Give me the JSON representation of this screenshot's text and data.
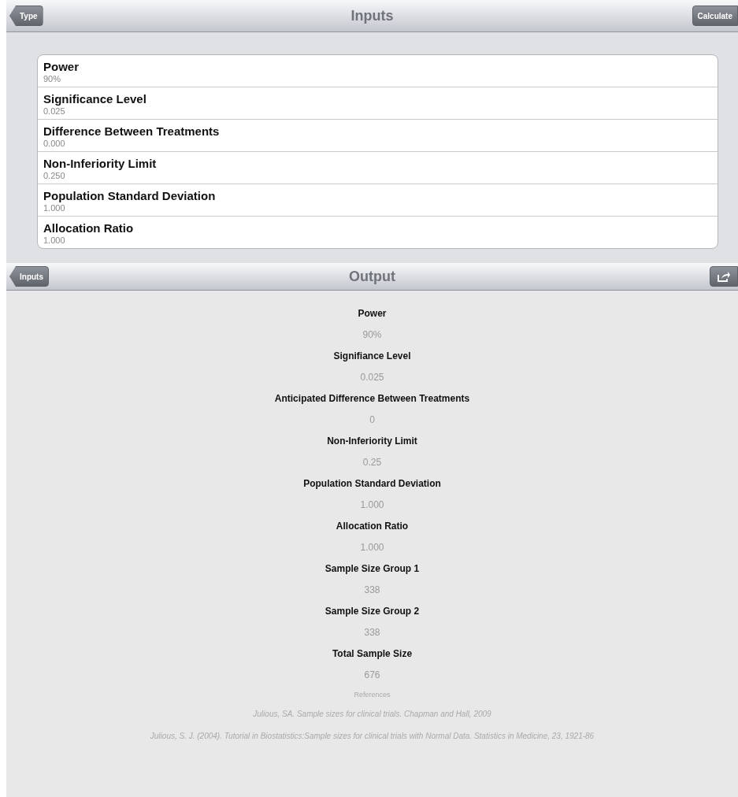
{
  "inputs_bar": {
    "back_button": "Type",
    "title": "Inputs",
    "action_button": "Calculate"
  },
  "inputs": [
    {
      "label": "Power",
      "value": "90%"
    },
    {
      "label": "Significance Level",
      "value": "0.025"
    },
    {
      "label": "Difference Between Treatments",
      "value": "0.000"
    },
    {
      "label": "Non-Inferiority Limit",
      "value": "0.250"
    },
    {
      "label": "Population Standard Deviation",
      "value": "1.000"
    },
    {
      "label": "Allocation Ratio",
      "value": "1.000"
    }
  ],
  "output_bar": {
    "back_button": "Inputs",
    "title": "Output"
  },
  "output": [
    {
      "label": "Power",
      "value": "90%"
    },
    {
      "label": "Signifiance Level",
      "value": "0.025"
    },
    {
      "label": "Anticipated Difference Between Treatments",
      "value": "0"
    },
    {
      "label": "Non-Inferiority Limit",
      "value": "0.25"
    },
    {
      "label": "Population Standard Deviation",
      "value": "1.000"
    },
    {
      "label": "Allocation Ratio",
      "value": "1.000"
    },
    {
      "label": "Sample Size Group 1",
      "value": "338"
    },
    {
      "label": "Sample Size Group 2",
      "value": "338"
    },
    {
      "label": "Total Sample Size",
      "value": "676"
    }
  ],
  "references": {
    "heading": "References",
    "items": [
      "Julious, SA. Sample sizes for clinical trials. Chapman and Hall, 2009",
      "Julious, S. J. (2004). Tutorial in Biostatistics:Sample sizes for clinical trials with Normal Data. Statistics in Medicine, 23, 1921-86"
    ]
  }
}
